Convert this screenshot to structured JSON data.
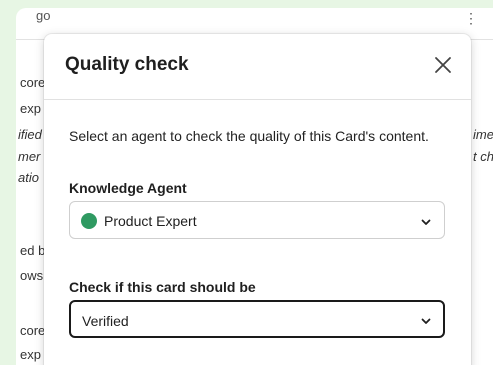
{
  "background": {
    "topbar_text": "go",
    "kebab_icon": "⋮",
    "edit_icon": "✎",
    "left_fragments": [
      "core",
      "exp",
      "ified",
      "mer",
      "atio",
      "ed b",
      "ows",
      "core",
      "exp"
    ],
    "right_fragments": [
      "ime",
      "t ch"
    ]
  },
  "modal": {
    "title": "Quality check",
    "close_icon": "close-icon",
    "description": "Select an agent to check the quality of this Card's content.",
    "agent_label": "Knowledge Agent",
    "agent_value": "Product Expert",
    "status_label": "Check if this card should be",
    "status_value": "Verified"
  },
  "colors": {
    "avatar": "#2f9a62",
    "page_bg": "#e7f6e4"
  }
}
